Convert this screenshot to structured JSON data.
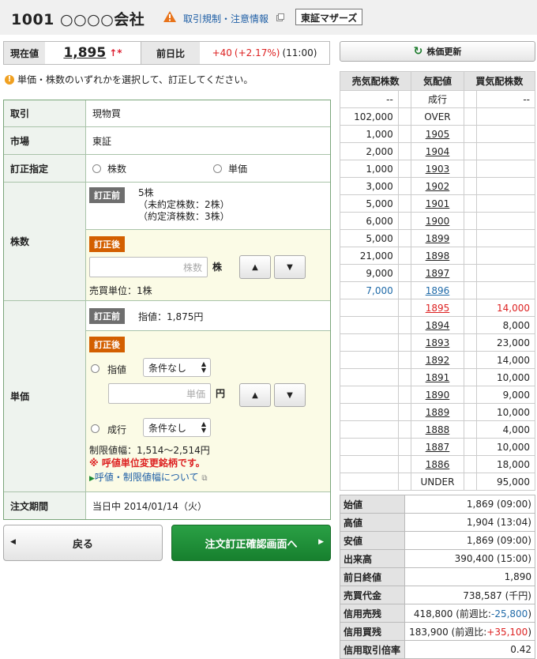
{
  "header": {
    "title": "1001 ○○○○会社",
    "regulation": "取引規制・注意情報",
    "market": "東証マザーズ"
  },
  "price": {
    "current_label": "現在値",
    "current": "1,895",
    "arrow": "↑*",
    "change_label": "前日比",
    "change": "+40",
    "change_pct": "(+2.17%)",
    "time": "(11:00)"
  },
  "refresh": "株価更新",
  "notice": "単価・株数のいずれかを選択して、訂正してください。",
  "form": {
    "torihiki_label": "取引",
    "torihiki": "現物買",
    "shijo_label": "市場",
    "shijo": "東証",
    "shitei_label": "訂正指定",
    "opt_kabu": "株数",
    "opt_tanka": "単価",
    "kabu_label": "株数",
    "before": "訂正前",
    "after": "訂正後",
    "kabu_before_1": "5株",
    "kabu_before_2": "（未約定株数：2株）",
    "kabu_before_3": "（約定済株数：3株）",
    "kabu_placeholder": "株数",
    "kabu_unit": "株",
    "baibai": "売買単位：1株",
    "tanka_label": "単価",
    "tanka_before": "指値：1,875円",
    "sashine": "指値",
    "nariyuki": "成行",
    "cond": "条件なし",
    "tanka_placeholder": "単価",
    "yen": "円",
    "limit": "制限値幅：1,514～2,514円",
    "warn": "※ 呼値単位変更銘柄です。",
    "link": "呼値・制限値幅について",
    "kikan_label": "注文期間",
    "kikan": "当日中 2014/01/14（火）"
  },
  "buttons": {
    "back": "戻る",
    "confirm": "注文訂正確認画面へ"
  },
  "board": {
    "headers": [
      "売気配株数",
      "気配値",
      "買気配株数"
    ],
    "rows": [
      {
        "sell": "--",
        "price": "成行",
        "buy": "--",
        "link": false
      },
      {
        "sell": "102,000",
        "price": "OVER",
        "buy": "",
        "link": false
      },
      {
        "sell": "1,000",
        "price": "1905",
        "buy": "",
        "link": true
      },
      {
        "sell": "2,000",
        "price": "1904",
        "buy": "",
        "link": true
      },
      {
        "sell": "1,000",
        "price": "1903",
        "buy": "",
        "link": true
      },
      {
        "sell": "3,000",
        "price": "1902",
        "buy": "",
        "link": true
      },
      {
        "sell": "5,000",
        "price": "1901",
        "buy": "",
        "link": true
      },
      {
        "sell": "6,000",
        "price": "1900",
        "buy": "",
        "link": true
      },
      {
        "sell": "5,000",
        "price": "1899",
        "buy": "",
        "link": true
      },
      {
        "sell": "21,000",
        "price": "1898",
        "buy": "",
        "link": true
      },
      {
        "sell": "9,000",
        "price": "1897",
        "buy": "",
        "link": true
      },
      {
        "sell": "7,000",
        "price": "1896",
        "buy": "",
        "link": true,
        "hl": "blue"
      },
      {
        "sell": "",
        "price": "1895",
        "buy": "14,000",
        "link": true,
        "hl": "red"
      },
      {
        "sell": "",
        "price": "1894",
        "buy": "8,000",
        "link": true
      },
      {
        "sell": "",
        "price": "1893",
        "buy": "23,000",
        "link": true
      },
      {
        "sell": "",
        "price": "1892",
        "buy": "14,000",
        "link": true
      },
      {
        "sell": "",
        "price": "1891",
        "buy": "10,000",
        "link": true
      },
      {
        "sell": "",
        "price": "1890",
        "buy": "9,000",
        "link": true
      },
      {
        "sell": "",
        "price": "1889",
        "buy": "10,000",
        "link": true
      },
      {
        "sell": "",
        "price": "1888",
        "buy": "4,000",
        "link": true
      },
      {
        "sell": "",
        "price": "1887",
        "buy": "10,000",
        "link": true
      },
      {
        "sell": "",
        "price": "1886",
        "buy": "18,000",
        "link": true
      },
      {
        "sell": "",
        "price": "UNDER",
        "buy": "95,000",
        "link": false
      }
    ]
  },
  "stats": [
    {
      "k": "始値",
      "v": "1,869 (09:00)"
    },
    {
      "k": "高値",
      "v": "1,904 (13:04)"
    },
    {
      "k": "安値",
      "v": "1,869 (09:00)"
    },
    {
      "k": "出来高",
      "v": "390,400 (15:00)"
    },
    {
      "k": "前日終値",
      "v": "1,890"
    },
    {
      "k": "売買代金",
      "v": "738,587 (千円)"
    },
    {
      "k": "信用売残",
      "v": "418,800 (前週比:",
      "d": "-25,800",
      "dc": "blue"
    },
    {
      "k": "信用買残",
      "v": "183,900 (前週比:",
      "d": "+35,100",
      "dc": "red"
    },
    {
      "k": "信用取引倍率",
      "v": "0.42"
    }
  ],
  "colors": {
    "green": "#1d8a33",
    "orange": "#d35f00"
  }
}
